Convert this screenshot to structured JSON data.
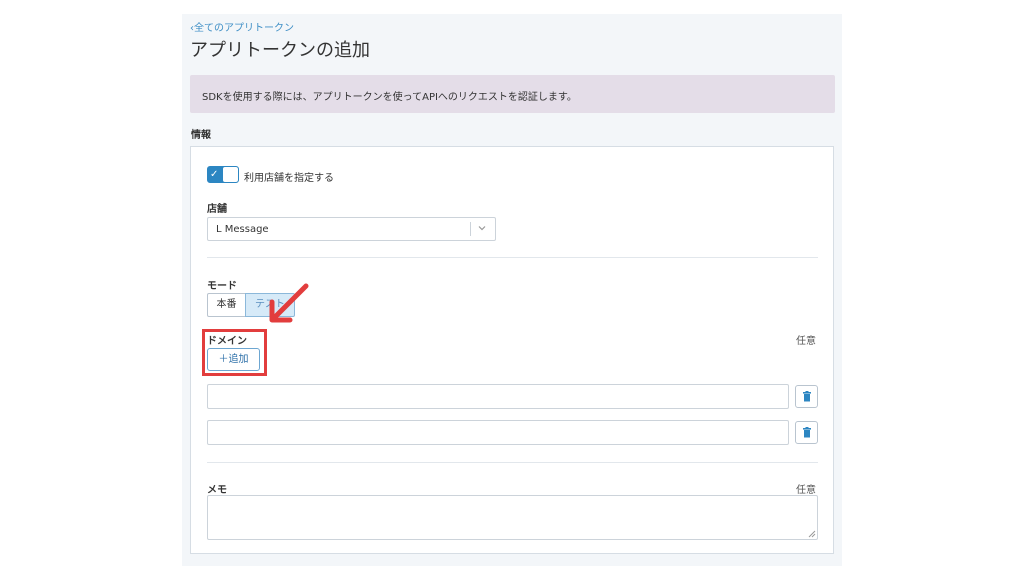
{
  "breadcrumb": {
    "back_label": "‹全てのアプリトークン"
  },
  "page": {
    "title": "アプリトークンの追加"
  },
  "banner": {
    "text": "SDKを使用する際には、アプリトークンを使ってAPIへのリクエストを認証します。"
  },
  "section": {
    "title": "情報"
  },
  "store_toggle": {
    "label": "利用店舗を指定する",
    "checked": true,
    "icon": "check-icon"
  },
  "store": {
    "label": "店舗",
    "selected": "L Message"
  },
  "mode": {
    "label": "モード",
    "options": [
      "本番",
      "テスト"
    ],
    "selected_option": "テスト"
  },
  "domain": {
    "label": "ドメイン",
    "optional": "任意",
    "add_label": "＋追加",
    "inputs": [
      {
        "value": ""
      },
      {
        "value": ""
      }
    ],
    "delete_icon": "trash-icon"
  },
  "memo": {
    "label": "メモ",
    "optional": "任意",
    "value": ""
  },
  "annotation": {
    "color": "#e23d3d"
  },
  "colors": {
    "accent": "#2c86c2",
    "banner_bg": "#e4dde8",
    "annotation": "#e23d3d"
  }
}
